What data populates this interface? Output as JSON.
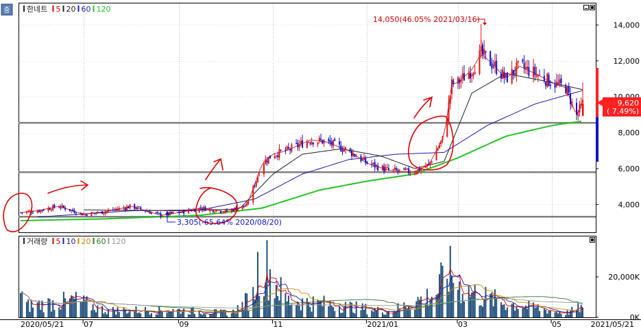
{
  "price_legend": [
    {
      "text": "한네트",
      "color": "#222222"
    },
    {
      "text": "5",
      "color": "#cc0000"
    },
    {
      "text": "20",
      "color": "#222222"
    },
    {
      "text": "60",
      "color": "#1a1aa8"
    },
    {
      "text": "120",
      "color": "#22c422"
    }
  ],
  "volume_legend": [
    {
      "text": "거래량",
      "color": "#222222"
    },
    {
      "text": "5",
      "color": "#cc0000"
    },
    {
      "text": "10",
      "color": "#1a1aa8"
    },
    {
      "text": "20",
      "color": "#d08a00"
    },
    {
      "text": "60",
      "color": "#2a7a2a"
    },
    {
      "text": "120",
      "color": "#999999"
    }
  ],
  "annotations": {
    "high": "14,050(46.05% 2021/03/16)",
    "low": "3,305(-65.64% 2020/08/20)"
  },
  "current_price": {
    "value": "9,620",
    "change": "(  7.49%)",
    "color": "#ff2020"
  },
  "colors": {
    "up": "#dd1111",
    "down": "#1111cc",
    "ma5": "#cc0000",
    "ma20": "#222222",
    "ma60": "#1a1aa8",
    "ma120": "#22c422",
    "support_line": "#808080",
    "sketch": "#e00000",
    "volume_bar": "#1f4e79"
  },
  "chart_data": [
    {
      "type": "candlestick",
      "title": "한네트",
      "y_ticks": [
        "4,000",
        "6,000",
        "8,000",
        "10,000",
        "12,000",
        "14,000"
      ],
      "ylim": [
        2450,
        15200
      ],
      "x_ticks": [
        "2020/05/21",
        "07",
        "09",
        "11",
        "2021/01",
        "03",
        "05",
        "2021/05/21"
      ],
      "x_range": [
        "2020/05/21",
        "2021/05/21"
      ],
      "grid": "vertical dotted at month ticks",
      "high": {
        "date": "2021/03/16",
        "value": 14050,
        "pct": 46.05
      },
      "low": {
        "date": "2020/08/20",
        "value": 3305,
        "pct": -65.64
      },
      "last": {
        "value": 9620,
        "pct": 7.49
      },
      "support_levels": [
        8550,
        5800,
        3320
      ],
      "price_path": {
        "dates": [
          "2020/05/21",
          "2020/06/01",
          "2020/06/15",
          "2020/07/01",
          "2020/07/15",
          "2020/08/01",
          "2020/08/20",
          "2020/09/01",
          "2020/09/15",
          "2020/10/01",
          "2020/10/15",
          "2020/10/25",
          "2020/11/01",
          "2020/11/10",
          "2020/11/25",
          "2020/12/05",
          "2020/12/20",
          "2021/01/01",
          "2021/01/15",
          "2021/01/31",
          "2021/02/10",
          "2021/02/20",
          "2021/02/25",
          "2021/03/01",
          "2021/03/10",
          "2021/03/16",
          "2021/03/25",
          "2021/04/01",
          "2021/04/10",
          "2021/04/20",
          "2021/05/01",
          "2021/05/10",
          "2021/05/17",
          "2021/05/21"
        ],
        "close": [
          3550,
          3650,
          3900,
          3450,
          3600,
          3900,
          3400,
          3550,
          3800,
          3600,
          3950,
          6300,
          6800,
          7000,
          7600,
          7500,
          7000,
          6300,
          5900,
          5800,
          6200,
          7800,
          10700,
          10800,
          11500,
          12400,
          11700,
          11000,
          11700,
          11300,
          10800,
          10500,
          8950,
          9620
        ]
      },
      "moving_averages": {
        "ma20": {
          "dates": [
            "2020/07/01",
            "2020/09/01",
            "2020/10/10",
            "2020/11/01",
            "2020/11/20",
            "2020/12/15",
            "2021/01/10",
            "2021/02/01",
            "2021/02/20",
            "2021/03/10",
            "2021/04/01",
            "2021/04/25",
            "2021/05/21"
          ],
          "values": [
            3700,
            3650,
            3750,
            5700,
            6800,
            7100,
            6700,
            6000,
            6400,
            10200,
            11300,
            10900,
            10400
          ]
        },
        "ma60": {
          "dates": [
            "2020/06/01",
            "2020/08/01",
            "2020/09/15",
            "2020/10/20",
            "2020/11/20",
            "2020/12/20",
            "2021/01/20",
            "2021/02/20",
            "2021/03/20",
            "2021/04/20",
            "2021/05/21"
          ],
          "values": [
            3300,
            3650,
            3700,
            4300,
            5700,
            6500,
            6800,
            6900,
            8400,
            9600,
            10350
          ]
        },
        "ma120": {
          "dates": [
            "2020/05/21",
            "2020/07/15",
            "2020/09/15",
            "2020/10/25",
            "2020/12/01",
            "2021/01/01",
            "2021/02/01",
            "2021/03/01",
            "2021/04/01",
            "2021/05/01",
            "2021/05/21"
          ],
          "values": [
            3100,
            3200,
            3400,
            3800,
            4800,
            5300,
            5700,
            6600,
            7800,
            8400,
            8650
          ]
        }
      }
    },
    {
      "type": "bar",
      "title": "거래량",
      "y_ticks": [
        "20,000K",
        "0K"
      ],
      "ylim": [
        0,
        40000
      ],
      "unit": "K",
      "volume_profile": {
        "dates": [
          "2020/05/21",
          "2020/05/25",
          "2020/06/25",
          "2020/07/15",
          "2020/09/01",
          "2020/10/05",
          "2020/10/19",
          "2020/10/22",
          "2020/10/27",
          "2020/11/01",
          "2020/11/10",
          "2020/12/10",
          "2021/01/15",
          "2021/02/15",
          "2021/02/22",
          "2021/02/25",
          "2021/03/02",
          "2021/03/10",
          "2021/04/01",
          "2021/05/10",
          "2021/05/20",
          "2021/05/21"
        ],
        "values": [
          18000,
          8000,
          12000,
          5000,
          5000,
          3000,
          15000,
          34000,
          38000,
          26000,
          12000,
          9000,
          4000,
          17000,
          33000,
          30000,
          22000,
          17000,
          10000,
          3000,
          7000,
          5000
        ]
      }
    }
  ]
}
